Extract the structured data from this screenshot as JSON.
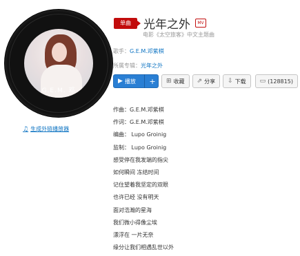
{
  "cover": {
    "caption": "G.E.M. 邓"
  },
  "outlink_label": "生成外链播放器",
  "song": {
    "badge": "单曲",
    "title": "光年之外",
    "mv_label": "MV",
    "subtitle": "电影《太空旅客》中文主题曲"
  },
  "singer": {
    "label": "歌手：",
    "name": "G.E.M.邓紫棋"
  },
  "album": {
    "label": "所属专辑：",
    "name": "光年之外"
  },
  "buttons": {
    "play": "播放",
    "add": "+",
    "collect": "收藏",
    "share": "分享",
    "download": "下载",
    "comments": "(128815)"
  },
  "lyrics": [
    "作曲：G.E.M.邓紫棋",
    "作词：G.E.M.邓紫棋",
    "编曲： Lupo Groinig",
    "监制： Lupo Groinig",
    "感受停在我发端的指尖",
    "如何瞬间 冻结时间",
    "记住望着我坚定的双眼",
    "也许已经 没有明天",
    "面对浩瀚的星海",
    "我们微小得像尘埃",
    "漂浮在 一片无奈",
    "缘分让我们相遇乱世以外"
  ]
}
